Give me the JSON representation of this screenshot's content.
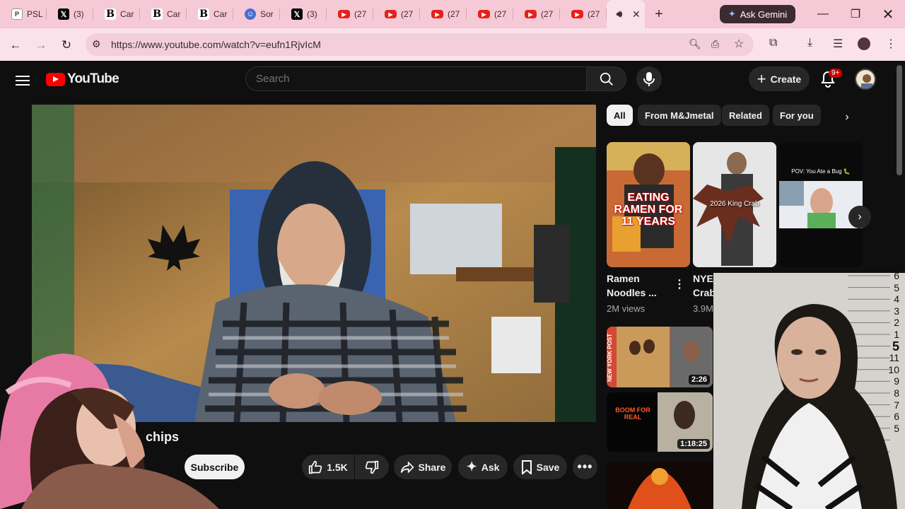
{
  "browser": {
    "tabs": [
      {
        "icon": "p",
        "label": "PSL"
      },
      {
        "icon": "x",
        "label": "(3)"
      },
      {
        "icon": "b",
        "label": "Car"
      },
      {
        "icon": "b",
        "label": "Car"
      },
      {
        "icon": "b",
        "label": "Car"
      },
      {
        "icon": "s",
        "label": "Sor"
      },
      {
        "icon": "x",
        "label": "(3)"
      },
      {
        "icon": "yt",
        "label": "(27"
      },
      {
        "icon": "yt",
        "label": "(27"
      },
      {
        "icon": "yt",
        "label": "(27"
      },
      {
        "icon": "yt",
        "label": "(27"
      },
      {
        "icon": "yt",
        "label": "(27"
      },
      {
        "icon": "yt",
        "label": "(27"
      }
    ],
    "new_tab": "+",
    "ask_gemini": "Ask Gemini",
    "url": "https://www.youtube.com/watch?v=eufn1RjvIcM",
    "accent": "#f6c9d6"
  },
  "youtube": {
    "logo_text": "YouTube",
    "search_placeholder": "Search",
    "create_label": "Create",
    "notification_badge": "9+",
    "video_title": "chips",
    "subscribe": "Subscribe",
    "likes": "1.5K",
    "share": "Share",
    "ask": "Ask",
    "save": "Save",
    "chips": [
      "All",
      "From M&Jmetal",
      "Related",
      "For you"
    ],
    "shorts": [
      {
        "title": "Ramen Noodles ...",
        "views": "2M views",
        "overlay": "EATING RAMEN FOR 11 YEARS"
      },
      {
        "title": "NYE Crab",
        "views": "3.9M",
        "overlay": "2026 King Crab"
      },
      {
        "title": "",
        "views": "",
        "overlay": "POV: You Ate a Bug 🐛"
      }
    ],
    "videos": [
      {
        "duration": "2:26",
        "overlay": "NEW YORK POST"
      },
      {
        "duration": "1:18:25",
        "overlay": "BOOM FOR REAL"
      },
      {
        "duration": "",
        "overlay": ""
      }
    ]
  },
  "mugshot": {
    "scale": [
      "6",
      "5",
      "4",
      "3",
      "2",
      "1",
      "5",
      "11",
      "10",
      "9",
      "8",
      "7",
      "6",
      "5"
    ]
  }
}
